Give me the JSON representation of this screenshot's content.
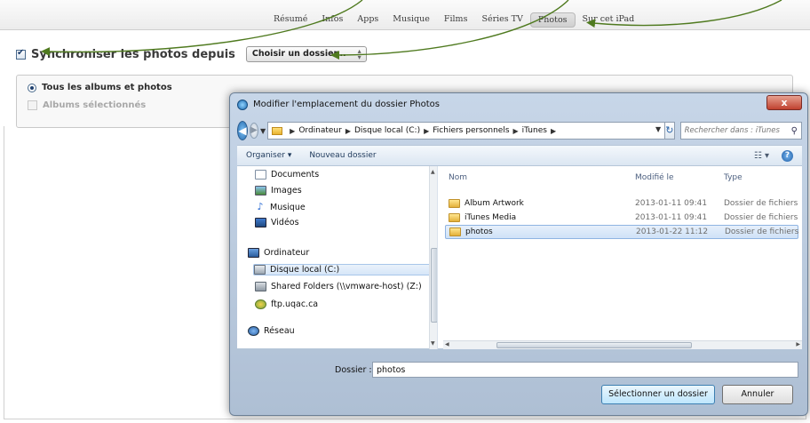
{
  "tabs": [
    {
      "label": "Résumé"
    },
    {
      "label": "Infos"
    },
    {
      "label": "Apps"
    },
    {
      "label": "Musique"
    },
    {
      "label": "Films"
    },
    {
      "label": "Séries TV"
    },
    {
      "label": "Photos",
      "active": true
    },
    {
      "label": "Sur cet iPad"
    }
  ],
  "sync": {
    "label": "Synchroniser les photos depuis",
    "checked": true,
    "folder_select": "Choisir un dossier..."
  },
  "options": {
    "all": "Tous les albums et photos",
    "selected": "Albums sélectionnés"
  },
  "dialog": {
    "title": "Modifier l'emplacement du dossier Photos",
    "close_label": "x",
    "path": [
      "Ordinateur",
      "Disque local (C:)",
      "Fichiers personnels",
      "iTunes"
    ],
    "search_placeholder": "Rechercher dans : iTunes",
    "toolbar": {
      "organize": "Organiser ▾",
      "new_folder": "Nouveau dossier"
    },
    "nav_items": [
      {
        "label": "Documents",
        "icon": "document-icon"
      },
      {
        "label": "Images",
        "icon": "images-icon"
      },
      {
        "label": "Musique",
        "icon": "music-icon"
      },
      {
        "label": "Vidéos",
        "icon": "video-icon"
      },
      {
        "label": "Ordinateur",
        "icon": "computer-icon"
      },
      {
        "label": "Disque local (C:)",
        "icon": "local-disk-icon",
        "selected": true
      },
      {
        "label": "Shared Folders (\\\\vmware-host) (Z:)",
        "icon": "network-drive-icon"
      },
      {
        "label": "ftp.uqac.ca",
        "icon": "ftp-icon"
      },
      {
        "label": "Réseau",
        "icon": "network-icon"
      }
    ],
    "columns": {
      "name": "Nom",
      "modified": "Modifié le",
      "type": "Type"
    },
    "files": [
      {
        "name": "Album Artwork",
        "modified": "2013-01-11 09:41",
        "type": "Dossier de fichiers"
      },
      {
        "name": "iTunes Media",
        "modified": "2013-01-11 09:41",
        "type": "Dossier de fichiers"
      },
      {
        "name": "photos",
        "modified": "2013-01-22 11:12",
        "type": "Dossier de fichiers",
        "selected": true
      }
    ],
    "folder_label": "Dossier :",
    "folder_value": "photos",
    "select_button": "Sélectionner un dossier",
    "cancel_button": "Annuler"
  },
  "colors": {
    "annotation_arrow": "#4f7a1f",
    "dialog_frame": "#aebfd4",
    "selection": "#cfe2f7"
  }
}
